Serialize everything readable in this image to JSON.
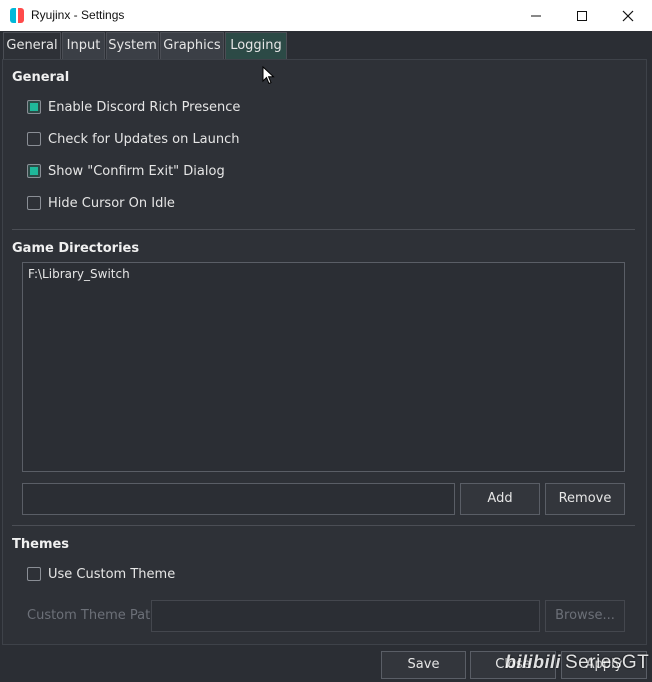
{
  "window": {
    "title": "Ryujinx - Settings"
  },
  "tabs": [
    {
      "label": "General"
    },
    {
      "label": "Input"
    },
    {
      "label": "System"
    },
    {
      "label": "Graphics"
    },
    {
      "label": "Logging"
    }
  ],
  "general": {
    "title": "General",
    "options": [
      {
        "label": "Enable Discord Rich Presence",
        "checked": true
      },
      {
        "label": "Check for Updates on Launch",
        "checked": false
      },
      {
        "label": "Show \"Confirm Exit\" Dialog",
        "checked": true
      },
      {
        "label": "Hide Cursor On Idle",
        "checked": false
      }
    ]
  },
  "game_directories": {
    "title": "Game Directories",
    "items": [
      "F:\\Library_Switch"
    ],
    "input_value": "",
    "add_label": "Add",
    "remove_label": "Remove"
  },
  "themes": {
    "title": "Themes",
    "use_custom_label": "Use Custom Theme",
    "use_custom_checked": false,
    "path_label": "Custom Theme Path:",
    "path_value": "",
    "browse_label": "Browse..."
  },
  "footer": {
    "save_label": "Save",
    "close_label": "Close",
    "apply_label": "Apply"
  },
  "watermark": {
    "logo": "bilibili",
    "text": "SeriesGT"
  },
  "colors": {
    "accent": "#1fb89a",
    "background": "#2e3137",
    "active_tab": "#2c4a46"
  }
}
